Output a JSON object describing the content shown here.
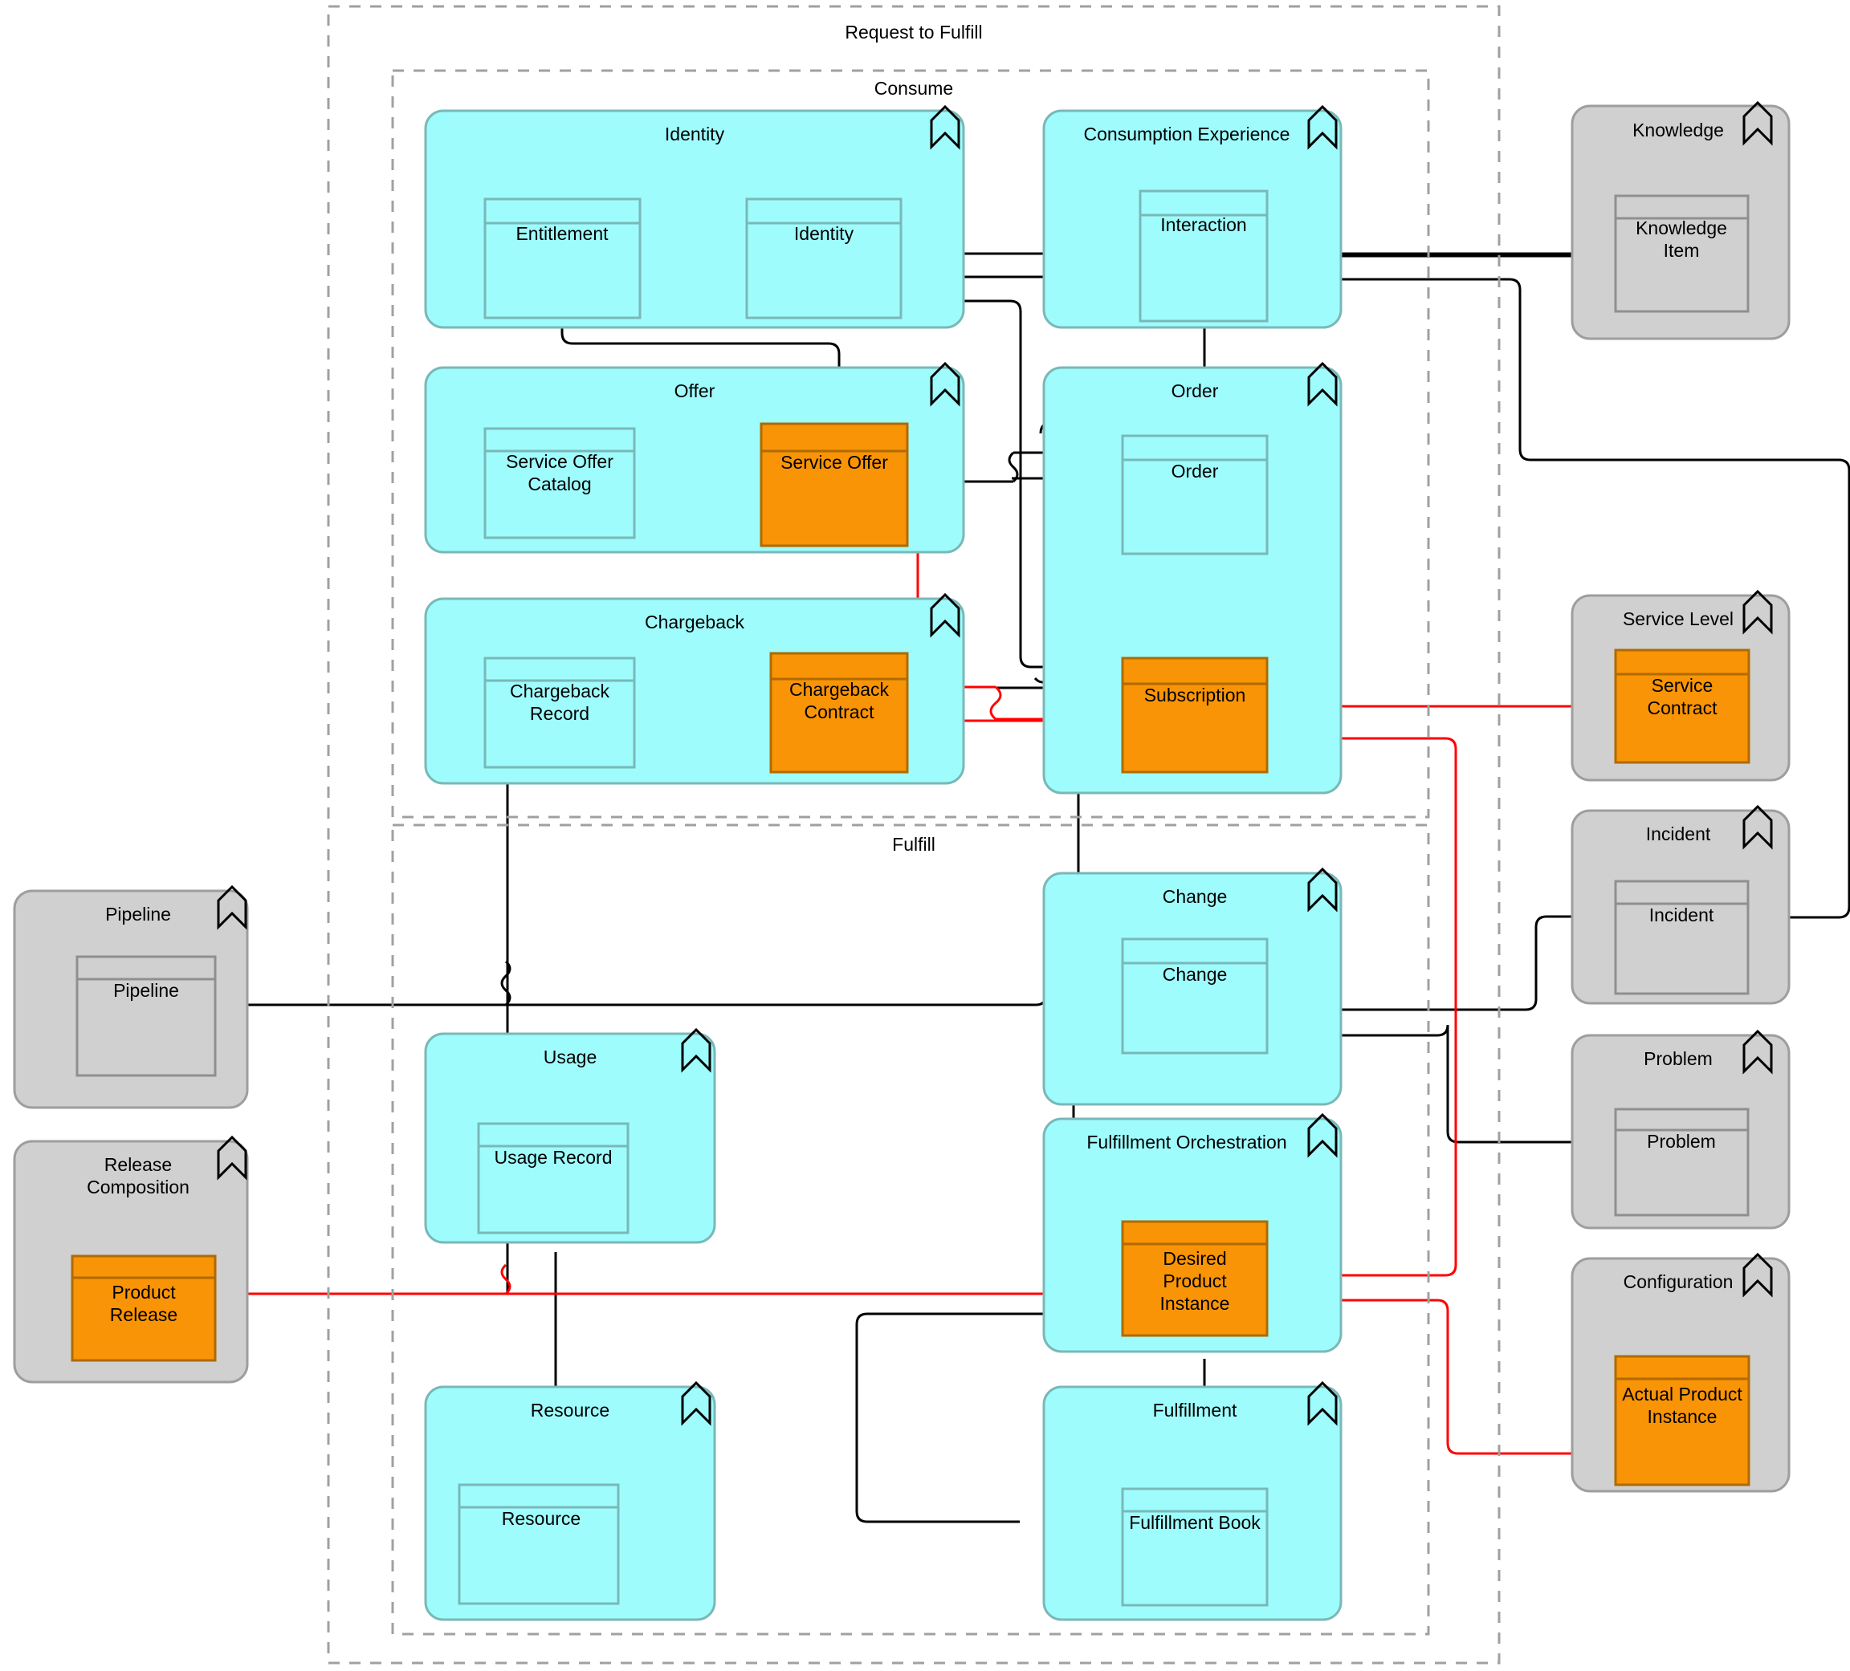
{
  "colors": {
    "cyan_fill": "#9ffcfc",
    "cyan_stroke": "#7ab8b8",
    "gray_fill": "#d0d0d0",
    "gray_stroke": "#9e9e9e",
    "orange_fill": "#f89406",
    "orange_stroke": "#b06a00",
    "entity_stroke_cyan": "#7ab8b8",
    "entity_stroke_gray": "#8f8f8f",
    "link_black": "#000000",
    "link_red": "#ff0000",
    "dashed_gray": "#a0a0a0"
  },
  "containers": {
    "outer": {
      "label": "Request to Fulfill"
    },
    "consume": {
      "label": "Consume"
    },
    "fulfill": {
      "label": "Fulfill"
    }
  },
  "groups": [
    {
      "id": "identity",
      "label": "Identity",
      "style": "cyan",
      "icon": "grouping-icon"
    },
    {
      "id": "consumption",
      "label": "Consumption Experience",
      "style": "cyan",
      "icon": "grouping-icon"
    },
    {
      "id": "knowledge",
      "label": "Knowledge",
      "style": "gray",
      "icon": "grouping-icon"
    },
    {
      "id": "offer",
      "label": "Offer",
      "style": "cyan",
      "icon": "grouping-icon"
    },
    {
      "id": "order",
      "label": "Order",
      "style": "cyan",
      "icon": "grouping-icon"
    },
    {
      "id": "chargeback",
      "label": "Chargeback",
      "style": "cyan",
      "icon": "grouping-icon"
    },
    {
      "id": "servicelevel",
      "label": "Service Level",
      "style": "gray",
      "icon": "grouping-icon"
    },
    {
      "id": "incident",
      "label": "Incident",
      "style": "gray",
      "icon": "grouping-icon"
    },
    {
      "id": "change",
      "label": "Change",
      "style": "cyan",
      "icon": "grouping-icon"
    },
    {
      "id": "pipeline",
      "label": "Pipeline",
      "style": "gray",
      "icon": "grouping-icon"
    },
    {
      "id": "problem",
      "label": "Problem",
      "style": "gray",
      "icon": "grouping-icon"
    },
    {
      "id": "usage",
      "label": "Usage",
      "style": "cyan",
      "icon": "grouping-icon"
    },
    {
      "id": "fulfillorch",
      "label": "Fulfillment Orchestration",
      "style": "cyan",
      "icon": "grouping-icon"
    },
    {
      "id": "releasecomp",
      "label": "Release Composition",
      "style": "gray",
      "icon": "grouping-icon"
    },
    {
      "id": "configuration",
      "label": "Configuration",
      "style": "gray",
      "icon": "grouping-icon"
    },
    {
      "id": "resource",
      "label": "Resource",
      "style": "cyan",
      "icon": "grouping-icon"
    },
    {
      "id": "fulfillment",
      "label": "Fulfillment",
      "style": "cyan",
      "icon": "grouping-icon"
    }
  ],
  "entities": [
    {
      "id": "entitlement",
      "label": "Entitlement",
      "group": "identity",
      "style": "plain-cyan"
    },
    {
      "id": "identity_e",
      "label": "Identity",
      "group": "identity",
      "style": "plain-cyan"
    },
    {
      "id": "interaction",
      "label": "Interaction",
      "group": "consumption",
      "style": "plain-cyan"
    },
    {
      "id": "knowledge_item",
      "label": "Knowledge Item",
      "group": "knowledge",
      "style": "plain-gray"
    },
    {
      "id": "service_offer_cat",
      "label": "Service Offer Catalog",
      "group": "offer",
      "style": "plain-cyan"
    },
    {
      "id": "service_offer",
      "label": "Service Offer",
      "group": "offer",
      "style": "orange"
    },
    {
      "id": "order_e",
      "label": "Order",
      "group": "order",
      "style": "plain-cyan"
    },
    {
      "id": "subscription",
      "label": "Subscription",
      "group": "order",
      "style": "orange"
    },
    {
      "id": "chargeback_rec",
      "label": "Chargeback Record",
      "group": "chargeback",
      "style": "plain-cyan"
    },
    {
      "id": "chargeback_con",
      "label": "Chargeback Contract",
      "group": "chargeback",
      "style": "orange"
    },
    {
      "id": "service_contract",
      "label": "Service Contract",
      "group": "servicelevel",
      "style": "orange"
    },
    {
      "id": "incident_e",
      "label": "Incident",
      "group": "incident",
      "style": "plain-gray"
    },
    {
      "id": "change_e",
      "label": "Change",
      "group": "change",
      "style": "plain-cyan"
    },
    {
      "id": "pipeline_e",
      "label": "Pipeline",
      "group": "pipeline",
      "style": "plain-gray"
    },
    {
      "id": "problem_e",
      "label": "Problem",
      "group": "problem",
      "style": "plain-gray"
    },
    {
      "id": "usage_record",
      "label": "Usage Record",
      "group": "usage",
      "style": "plain-cyan"
    },
    {
      "id": "desired_prod",
      "label": "Desired Product Instance",
      "group": "fulfillorch",
      "style": "orange"
    },
    {
      "id": "product_release",
      "label": "Product Release",
      "group": "releasecomp",
      "style": "orange"
    },
    {
      "id": "actual_prod",
      "label": "Actual Product Instance",
      "group": "configuration",
      "style": "orange"
    },
    {
      "id": "resource_e",
      "label": "Resource",
      "group": "resource",
      "style": "plain-cyan"
    },
    {
      "id": "fulfillment_book",
      "label": "Fulfillment Book",
      "group": "fulfillment",
      "style": "plain-cyan"
    }
  ]
}
